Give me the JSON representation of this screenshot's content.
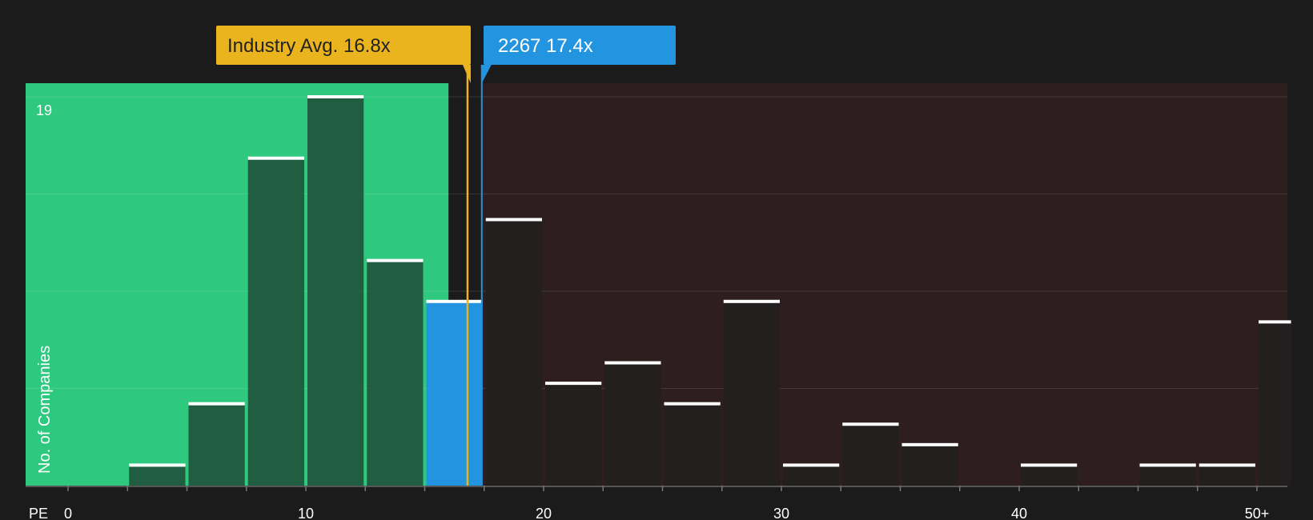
{
  "chart_data": {
    "type": "bar",
    "x_axis_label": "PE",
    "y_axis_label": "No. of Companies",
    "y_max_label": "19",
    "ylim": [
      0,
      19
    ],
    "x_ticks": [
      "0",
      "10",
      "20",
      "30",
      "40",
      "50+"
    ],
    "bins": [
      {
        "x0": 2.5,
        "x1": 5,
        "value": 1
      },
      {
        "x0": 5,
        "x1": 7.5,
        "value": 4
      },
      {
        "x0": 7.5,
        "x1": 10,
        "value": 16
      },
      {
        "x0": 10,
        "x1": 12.5,
        "value": 19
      },
      {
        "x0": 12.5,
        "x1": 15,
        "value": 11
      },
      {
        "x0": 15,
        "x1": 17.5,
        "value": 9,
        "highlight": true
      },
      {
        "x0": 17.5,
        "x1": 20,
        "value": 13
      },
      {
        "x0": 20,
        "x1": 22.5,
        "value": 5
      },
      {
        "x0": 22.5,
        "x1": 25,
        "value": 6
      },
      {
        "x0": 25,
        "x1": 27.5,
        "value": 4
      },
      {
        "x0": 27.5,
        "x1": 30,
        "value": 9
      },
      {
        "x0": 30,
        "x1": 32.5,
        "value": 1
      },
      {
        "x0": 32.5,
        "x1": 35,
        "value": 3
      },
      {
        "x0": 35,
        "x1": 37.5,
        "value": 2
      },
      {
        "x0": 40,
        "x1": 42.5,
        "value": 1
      },
      {
        "x0": 45,
        "x1": 47.5,
        "value": 1
      },
      {
        "x0": 47.5,
        "x1": 50,
        "value": 1
      },
      {
        "x0": 50,
        "x1": 51.5,
        "value": 8
      }
    ],
    "industry_avg": {
      "label": "Industry Avg. 16.8x",
      "value": 16.8
    },
    "company": {
      "label": "2267 17.4x",
      "value": 17.4
    },
    "colors": {
      "background": "#1b1b1b",
      "undervalued_region": "#2fc87f",
      "overvalued_region": "#2e1e1f",
      "bar_left": "#1f4a35",
      "bar_right": "#231f1f",
      "highlight_bar": "#2394e0",
      "industry_marker": "#eab41f",
      "company_marker": "#2394e0",
      "bar_cap": "#ffffff",
      "grid": "#4a3f40",
      "text": "#ffffff"
    }
  }
}
